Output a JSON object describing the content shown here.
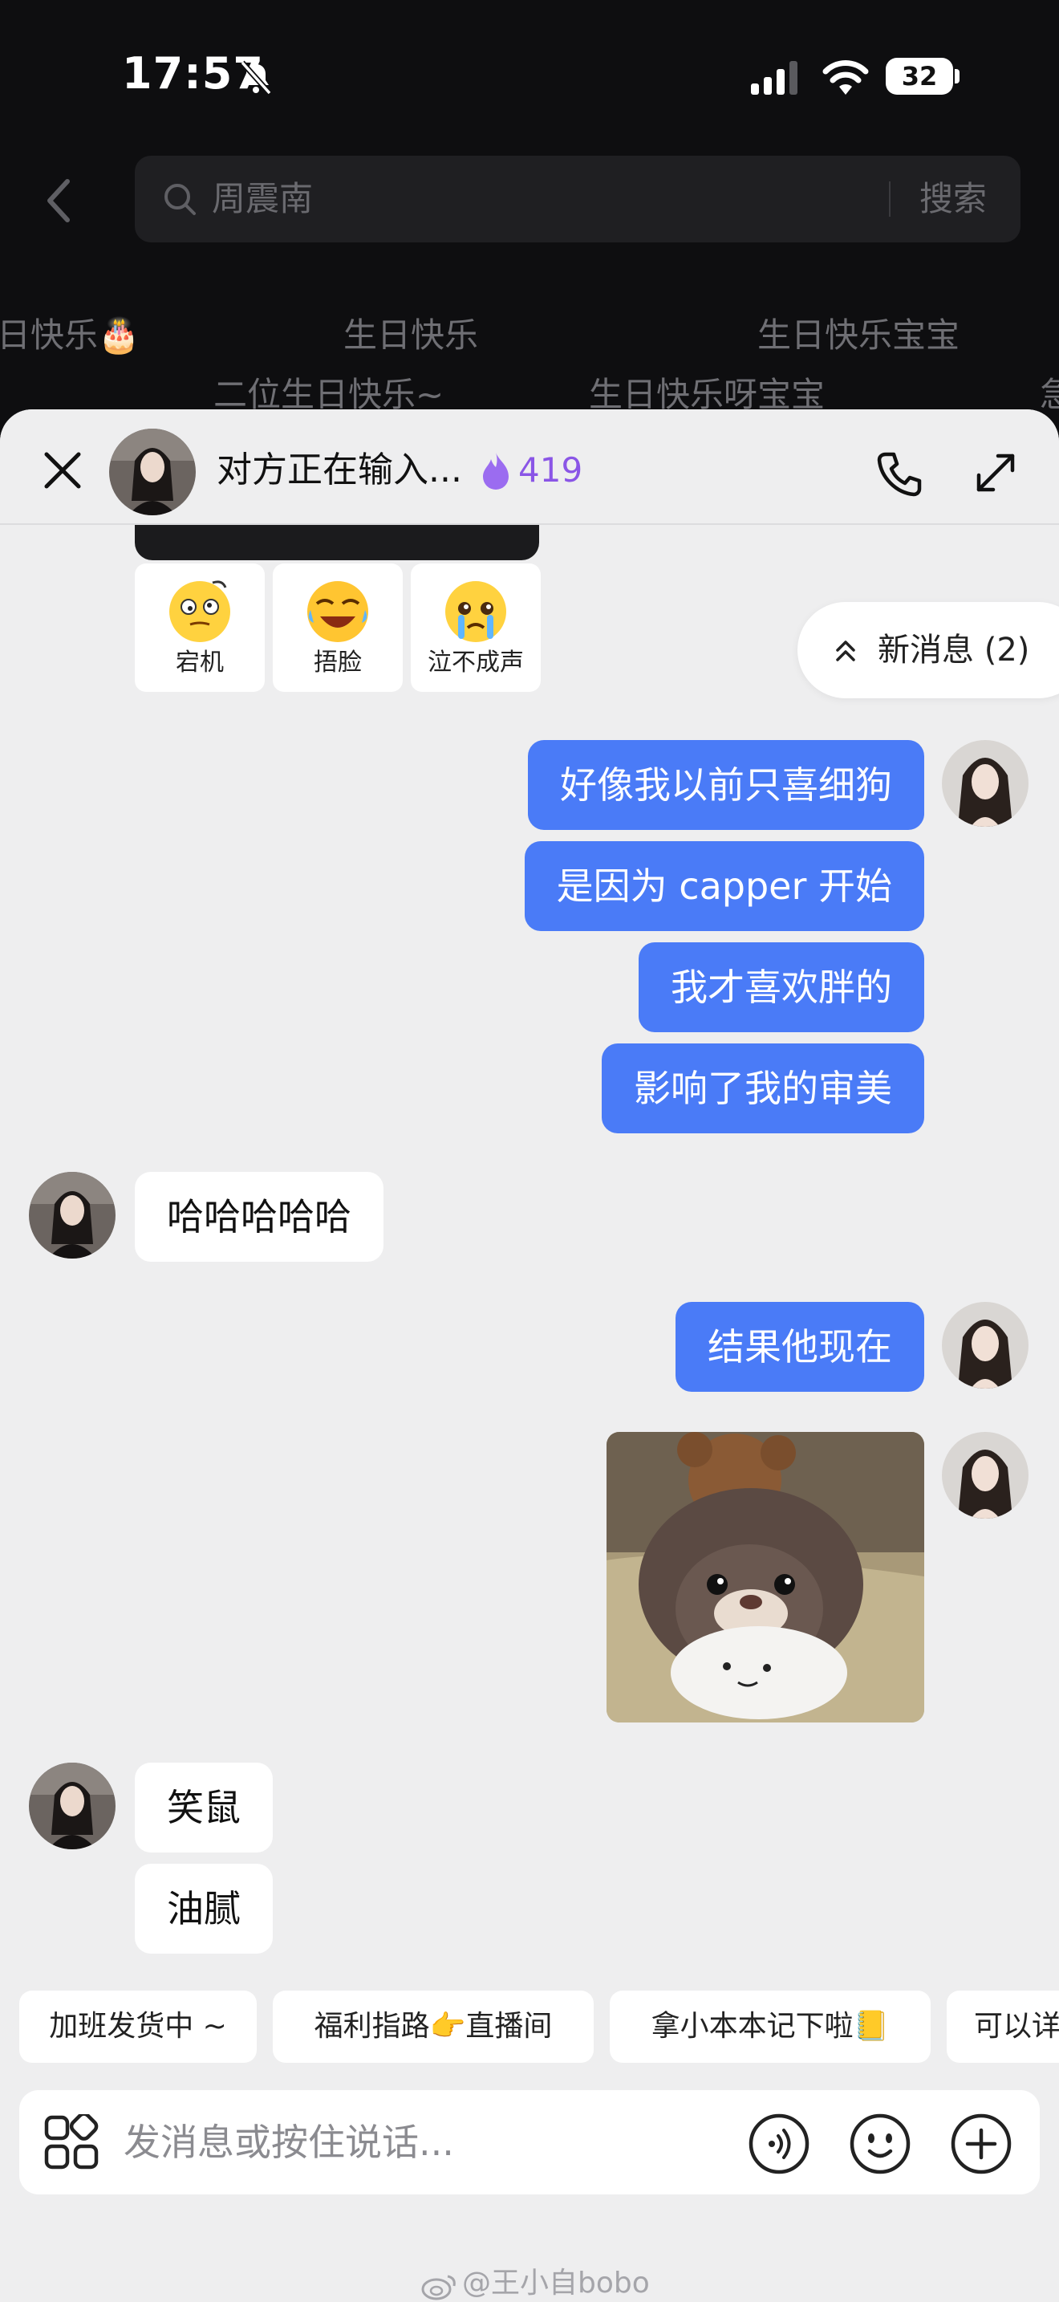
{
  "status_bar": {
    "time": "17:57",
    "battery": "32"
  },
  "background": {
    "search_query": "周震南",
    "search_button": "搜索",
    "suggestions_row1": [
      "日快乐🎂",
      "生日快乐",
      "生日快乐宝宝"
    ],
    "suggestions_row2": [
      "二位生日快乐~",
      "生日快乐呀宝宝",
      "急"
    ]
  },
  "chat_header": {
    "title": "对方正在输入...",
    "streak_count": "419",
    "streak_color": "#8a55e6"
  },
  "sticker_options": [
    {
      "label": "宕机",
      "icon": "dizzy-face-icon"
    },
    {
      "label": "捂脸",
      "icon": "laughing-tears-face-icon"
    },
    {
      "label": "泣不成声",
      "icon": "crying-face-icon"
    }
  ],
  "new_messages_pill": "新消息 (2)",
  "messages": [
    {
      "side": "out",
      "text": "好像我以前只喜细狗"
    },
    {
      "side": "out",
      "text": "是因为 capper 开始"
    },
    {
      "side": "out",
      "text": "我才喜欢胖的"
    },
    {
      "side": "out",
      "text": "影响了我的审美"
    },
    {
      "side": "in",
      "text": "哈哈哈哈哈"
    },
    {
      "side": "out",
      "text": "结果他现在"
    },
    {
      "side": "out",
      "type": "image",
      "icon": "otter-sticker-image"
    },
    {
      "side": "in",
      "text": "笑鼠"
    },
    {
      "side": "in",
      "text": "油腻"
    }
  ],
  "quick_replies": [
    "加班发货中 ~",
    "福利指路👉直播间",
    "拿小本本记下啦📒",
    "可以详"
  ],
  "input": {
    "placeholder": "发消息或按住说话..."
  },
  "watermark": "@王小自bobo",
  "colors": {
    "outgoing_bubble": "#4a7bf7",
    "incoming_bubble": "#ffffff",
    "sheet_bg": "#eeeeef"
  }
}
